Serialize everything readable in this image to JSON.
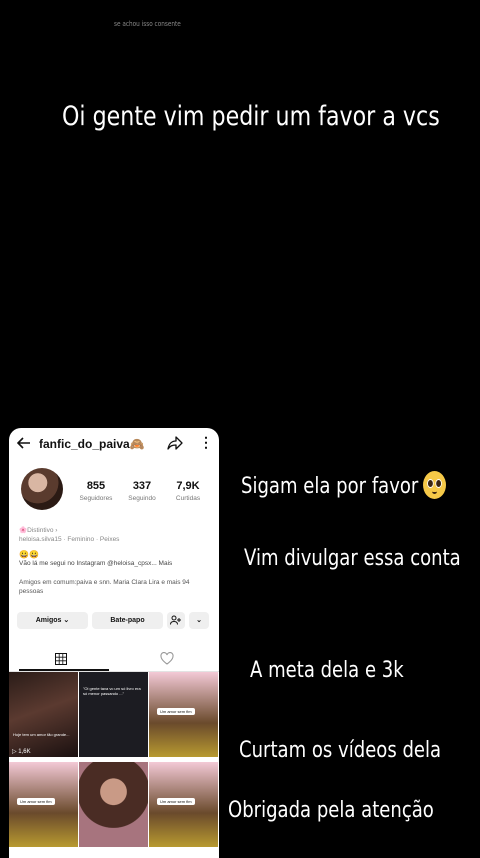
{
  "story": {
    "top_caption": "se achou isso consente",
    "headline": "Oi gente vim pedir um favor a vcs",
    "lines": [
      "Sigam ela por favor",
      "Vim divulgar essa conta",
      "A meta dela e 3k",
      "Curtam os vídeos dela",
      "Obrigada pela atenção"
    ]
  },
  "profile": {
    "username": "fanfic_do_paiva🙈",
    "stats": [
      {
        "value": "855",
        "label": "Seguidores"
      },
      {
        "value": "337",
        "label": "Seguindo"
      },
      {
        "value": "7,9K",
        "label": "Curtidas"
      }
    ],
    "category": "🌸Distintivo ›",
    "handle_line": "heloisa.silva15 · Feminino · Peixes",
    "bio_emoji": "😀😀",
    "bio": "Vão lá me segui no Instagram @heloisa_cpsx... Mais",
    "mutual": "Amigos em comum:paiva e snn.  Maria Clara Lira e mais 94 pessoas",
    "buttons": {
      "friends": "Amigos ⌄",
      "chat": "Bate-papo",
      "more": "⌄"
    },
    "thumbs": [
      {
        "text": "Hoje tem um amor tão grande...",
        "count": "▷ 1,6K"
      },
      {
        "text": "\"Oi gente tava vc um só livro era só menor passando ...\"",
        "count": ""
      },
      {
        "text": "",
        "count": ""
      },
      {
        "text": "",
        "count": ""
      },
      {
        "text": "",
        "count": ""
      },
      {
        "text": "",
        "count": ""
      }
    ],
    "thumb_caption": "Um amor sem fim"
  }
}
